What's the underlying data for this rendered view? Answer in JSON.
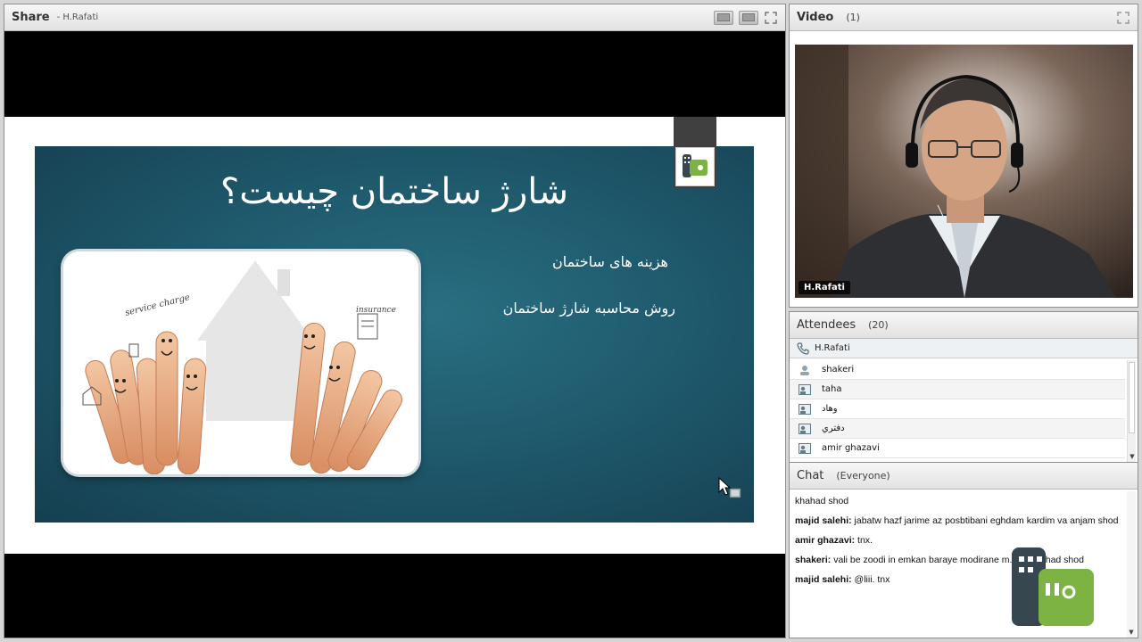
{
  "share": {
    "title": "Share",
    "presenter": "- H.Rafati"
  },
  "slide": {
    "title": "شارژ ساختمان چیست؟",
    "bullets": [
      "هزینه های ساختمان",
      "روش محاسبه شارژ ساختمان"
    ],
    "image_labels": {
      "service_charge": "service charge",
      "insurance": "insurance"
    }
  },
  "video": {
    "title": "Video",
    "count": "(1)",
    "participant": "H.Rafati"
  },
  "attendees": {
    "title": "Attendees",
    "count": "(20)",
    "host": "H.Rafati",
    "list": [
      "shakeri",
      "taha",
      "وهاد",
      "دفتري",
      "amir ghazavi"
    ]
  },
  "chat": {
    "title": "Chat",
    "scope": "(Everyone)",
    "messages": [
      {
        "sender": "",
        "text": "khahad shod"
      },
      {
        "sender": "majid salehi:",
        "text": "jabatw hazf jarime az posbtibani eghdam kardim va anjam shod"
      },
      {
        "sender": "amir ghazavi:",
        "text": "tnx."
      },
      {
        "sender": "shakeri:",
        "text": "vali be zoodi in emkan baraye modirane m... haz... had shod"
      },
      {
        "sender": "majid salehi:",
        "text": "@liii. tnx"
      }
    ]
  },
  "colors": {
    "slide_bg": "#1f5a6d",
    "logo_green": "#7cb342",
    "pod_header": "#e9e9e9"
  }
}
